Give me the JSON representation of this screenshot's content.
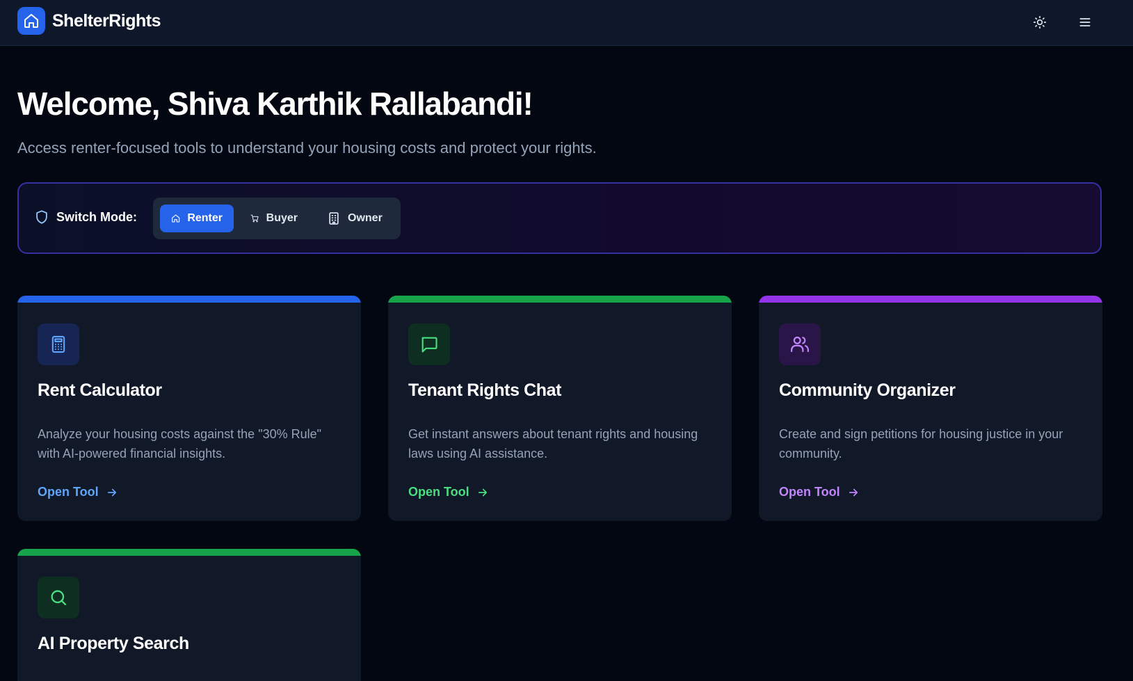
{
  "header": {
    "brand": "ShelterRights",
    "theme_icon": "sun-icon",
    "menu_icon": "hamburger-menu-icon"
  },
  "welcome": {
    "title": "Welcome, Shiva Karthik Rallabandi!",
    "subtitle": "Access renter-focused tools to understand your housing costs and protect your rights."
  },
  "mode": {
    "label": "Switch Mode:",
    "options": [
      {
        "label": "Renter",
        "icon": "home-icon",
        "active": true
      },
      {
        "label": "Buyer",
        "icon": "cart-icon",
        "active": false
      },
      {
        "label": "Owner",
        "icon": "building-icon",
        "active": false
      }
    ]
  },
  "tools": [
    {
      "title": "Rent Calculator",
      "description": "Analyze your housing costs against the \"30% Rule\" with AI-powered financial insights.",
      "link": "Open Tool",
      "icon": "calculator-icon",
      "accent": "#2563eb",
      "link_color": "#60a5fa",
      "icon_bg": "#172554",
      "icon_color": "#60a5fa"
    },
    {
      "title": "Tenant Rights Chat",
      "description": "Get instant answers about tenant rights and housing laws using AI assistance.",
      "link": "Open Tool",
      "icon": "chat-icon",
      "accent": "#16a34a",
      "link_color": "#4ade80",
      "icon_bg": "#0f2e22",
      "icon_color": "#4ade80"
    },
    {
      "title": "Community Organizer",
      "description": "Create and sign petitions for housing justice in your community.",
      "link": "Open Tool",
      "icon": "users-icon",
      "accent": "#9333ea",
      "link_color": "#c084fc",
      "icon_bg": "#2a1548",
      "icon_color": "#c084fc"
    },
    {
      "title": "AI Property Search",
      "description": "",
      "link": "",
      "icon": "search-icon",
      "accent": "#16a34a",
      "link_color": "#4ade80",
      "icon_bg": "#0f2e22",
      "icon_color": "#4ade80"
    }
  ]
}
